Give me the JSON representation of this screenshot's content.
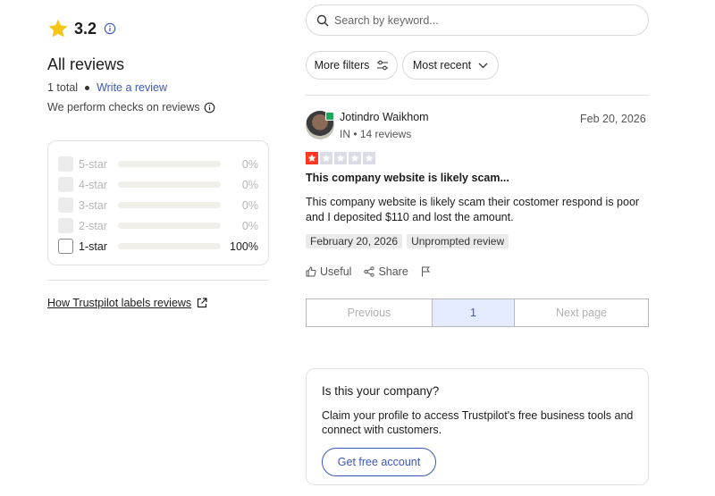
{
  "summary": {
    "rating": "3.2",
    "heading": "All reviews",
    "total": "1 total",
    "write_review": "Write a review",
    "checks": "We perform checks on reviews",
    "how_labels": "How Trustpilot labels reviews"
  },
  "distribution": [
    {
      "label": "5-star",
      "percent": "0%",
      "fill": 0,
      "active": false
    },
    {
      "label": "4-star",
      "percent": "0%",
      "fill": 0,
      "active": false
    },
    {
      "label": "3-star",
      "percent": "0%",
      "fill": 0,
      "active": false
    },
    {
      "label": "2-star",
      "percent": "0%",
      "fill": 0,
      "active": false
    },
    {
      "label": "1-star",
      "percent": "100%",
      "fill": 100,
      "active": true
    }
  ],
  "search": {
    "placeholder": "Search by keyword..."
  },
  "filters": {
    "filters_label": "More filters",
    "sort_label": "Most recent"
  },
  "review": {
    "name": "Jotindro Waikhom",
    "meta": "IN • 14 reviews",
    "date": "Feb 20, 2026",
    "stars": 1,
    "title": "This company website is likely scam...",
    "body": "This company website is likely scam their costomer respond is poor and I deposited $110 and lost the amount.",
    "tags": [
      "February 20, 2026",
      "Unprompted review"
    ],
    "useful": "Useful",
    "share": "Share"
  },
  "pagination": {
    "previous": "Previous",
    "current": "1",
    "next": "Next page"
  },
  "company_card": {
    "question": "Is this your company?",
    "description": "Claim your profile to access Trustpilot's free business tools and connect with customers.",
    "cta": "Get free account"
  },
  "colors": {
    "star_gold": "#f5c518",
    "star_red": "#ff3722",
    "link_blue": "#3c57bc",
    "verified_green": "#1aa85b"
  }
}
